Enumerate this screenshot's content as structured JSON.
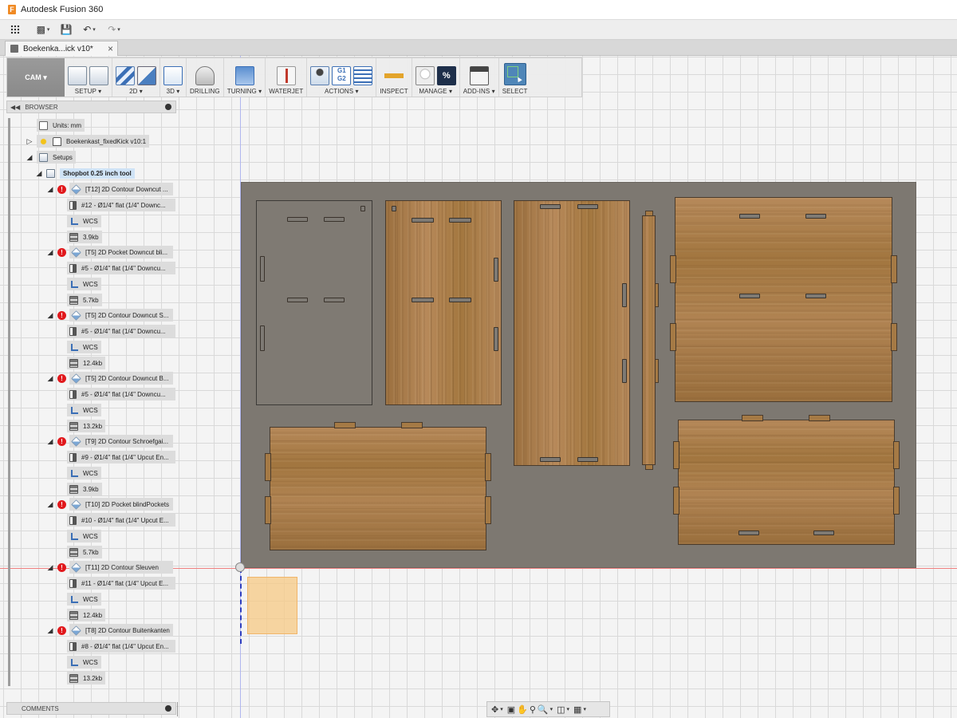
{
  "app": {
    "title": "Autodesk Fusion 360",
    "logo_letter": "F"
  },
  "quick_access": {
    "dropdown_glyph": "▾"
  },
  "document_tab": {
    "label": "Boekenka...ick v10*",
    "close_glyph": "×"
  },
  "toolbar": {
    "workspace": "CAM ▾",
    "groups": {
      "setup": "SETUP ▾",
      "two_d": "2D ▾",
      "three_d": "3D ▾",
      "drilling": "DRILLING",
      "turning": "TURNING ▾",
      "waterjet": "WATERJET",
      "actions": "ACTIONS ▾",
      "inspect": "INSPECT",
      "manage": "MANAGE ▾",
      "addins": "ADD-INS ▾",
      "select": "SELECT"
    },
    "g1g2_label": "G1\nG2",
    "percent_label": "%"
  },
  "browser": {
    "title": "BROWSER",
    "units": "Units: mm",
    "component": "Boekenkast_fixedKick v10:1",
    "setups": "Setups",
    "setup_name": "Shopbot 0.25 inch tool",
    "operations": [
      {
        "name": "[T12] 2D Contour Downcut ...",
        "tool": "#12 - Ø1/4\" flat (1/4\" Downc...",
        "wcs": "WCS",
        "size": "3.9kb"
      },
      {
        "name": "[T5] 2D Pocket Downcut bli...",
        "tool": "#5 - Ø1/4\" flat (1/4\" Downcu...",
        "wcs": "WCS",
        "size": "5.7kb"
      },
      {
        "name": "[T5] 2D Contour Downcut S...",
        "tool": "#5 - Ø1/4\" flat (1/4\" Downcu...",
        "wcs": "WCS",
        "size": "12.4kb"
      },
      {
        "name": "[T5] 2D Contour Downcut B...",
        "tool": "#5 - Ø1/4\" flat (1/4\" Downcu...",
        "wcs": "WCS",
        "size": "13.2kb"
      },
      {
        "name": "[T9] 2D Contour Schroefgai...",
        "tool": "#9 - Ø1/4\" flat (1/4\" Upcut En...",
        "wcs": "WCS",
        "size": "3.9kb"
      },
      {
        "name": "[T10] 2D Pocket blindPockets",
        "tool": "#10 - Ø1/4\" flat (1/4\" Upcut E...",
        "wcs": "WCS",
        "size": "5.7kb"
      },
      {
        "name": "[T11] 2D Contour Sleuven",
        "tool": "#11 - Ø1/4\" flat (1/4\" Upcut E...",
        "wcs": "WCS",
        "size": "12.4kb"
      },
      {
        "name": "[T8] 2D Contour Buitenkanten",
        "tool": "#8 - Ø1/4\" flat (1/4\" Upcut En...",
        "wcs": "WCS",
        "size": "13.2kb"
      }
    ]
  },
  "comments": {
    "title": "COMMENTS"
  },
  "colors": {
    "stock": "#7d7871",
    "wood": "#a57a45",
    "error": "#e1191d",
    "selection": "#cfe3f6",
    "select_button": "#4f86b8"
  }
}
